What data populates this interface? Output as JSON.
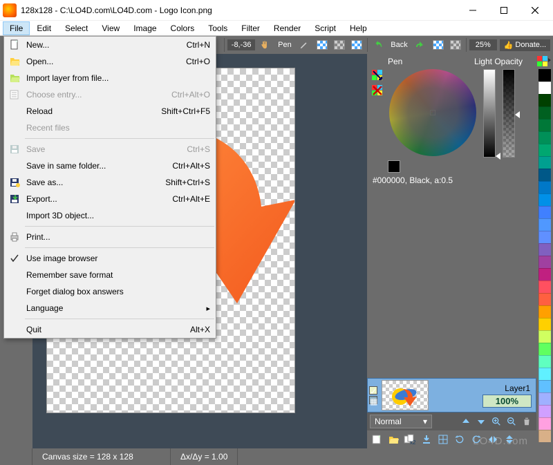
{
  "window": {
    "title": "128x128 - C:\\LO4D.com\\LO4D.com - Logo Icon.png"
  },
  "menubar": [
    "File",
    "Edit",
    "Select",
    "View",
    "Image",
    "Colors",
    "Tools",
    "Filter",
    "Render",
    "Script",
    "Help"
  ],
  "file_menu": [
    {
      "label": "New...",
      "shortcut": "Ctrl+N",
      "icon": "new-file"
    },
    {
      "label": "Open...",
      "shortcut": "Ctrl+O",
      "icon": "open-file"
    },
    {
      "label": "Import layer from file...",
      "icon": "import-file"
    },
    {
      "label": "Choose entry...",
      "shortcut": "Ctrl+Alt+O",
      "icon": "choose-entry",
      "disabled": true
    },
    {
      "label": "Reload",
      "shortcut": "Shift+Ctrl+F5"
    },
    {
      "label": "Recent files",
      "disabled": true
    },
    {
      "sep": true
    },
    {
      "label": "Save",
      "shortcut": "Ctrl+S",
      "icon": "save",
      "disabled": true
    },
    {
      "label": "Save in same folder...",
      "shortcut": "Ctrl+Alt+S"
    },
    {
      "label": "Save as...",
      "shortcut": "Shift+Ctrl+S",
      "icon": "save-as"
    },
    {
      "label": "Export...",
      "shortcut": "Ctrl+Alt+E",
      "icon": "export"
    },
    {
      "label": "Import 3D object..."
    },
    {
      "sep": true
    },
    {
      "label": "Print...",
      "icon": "print"
    },
    {
      "sep": true
    },
    {
      "label": "Use image browser",
      "icon": "check"
    },
    {
      "label": "Remember save format"
    },
    {
      "label": "Forget dialog box answers"
    },
    {
      "label": "Language",
      "submenu": true
    },
    {
      "sep": true
    },
    {
      "label": "Quit",
      "shortcut": "Alt+X"
    }
  ],
  "toolbar": {
    "coords": "-8,-36",
    "tool_name": "Pen",
    "back_label": "Back",
    "zoom": "25%",
    "donate": "Donate..."
  },
  "colorpanel": {
    "title_pen": "Pen",
    "title_light": "Light",
    "title_opacity": "Opacity",
    "readout": "#000000, Black, a:0.5"
  },
  "layers": {
    "layer_name": "Layer1",
    "opacity": "100%",
    "blend": "Normal"
  },
  "swatches": [
    "#000000",
    "#ffffff",
    "#004000",
    "#006020",
    "#007838",
    "#009058",
    "#00a770",
    "#00a090",
    "#005888",
    "#0078c8",
    "#0090e8",
    "#4080ff",
    "#5098ff",
    "#6090ff",
    "#8060c0",
    "#a040a0",
    "#c02080",
    "#ff5060",
    "#ff6040",
    "#ffa000",
    "#ffd000",
    "#d0ff60",
    "#60ff60",
    "#60ffc0",
    "#60f0ff",
    "#60c0ff",
    "#a0b0ff",
    "#d0a0ff",
    "#ffa0e0",
    "#d8b088"
  ],
  "statusbar": {
    "canvas_size_label": "Canvas size = 128 x 128",
    "delta_label": "Δx/Δy = 1.00"
  },
  "watermark": "LO4D.com"
}
